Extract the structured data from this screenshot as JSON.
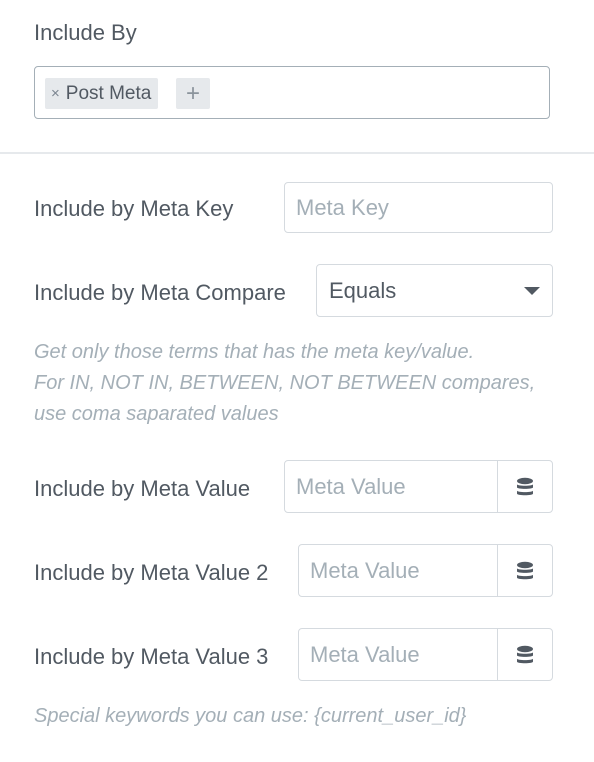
{
  "include_by": {
    "label": "Include By",
    "chip_label": "Post Meta",
    "chip_remove": "×",
    "add_label": "+"
  },
  "meta_key": {
    "label": "Include by Meta Key",
    "placeholder": "Meta Key"
  },
  "meta_compare": {
    "label": "Include by Meta Compare",
    "value": "Equals"
  },
  "help": {
    "line1": "Get only those terms that has the meta key/value.",
    "line2": "For IN, NOT IN, BETWEEN, NOT BETWEEN compares,",
    "line3": "use coma saparated values"
  },
  "meta_value": {
    "label": "Include by Meta Value",
    "placeholder": "Meta Value"
  },
  "meta_value_2": {
    "label": "Include by Meta Value 2",
    "placeholder": "Meta Value"
  },
  "meta_value_3": {
    "label": "Include by Meta Value 3",
    "placeholder": "Meta Value"
  },
  "keywords_note": "Special keywords you can use: {current_user_id}",
  "icons": {
    "dynamic": "database-icon",
    "dropdown": "caret-down-icon",
    "remove": "close-icon",
    "add": "plus-icon"
  }
}
